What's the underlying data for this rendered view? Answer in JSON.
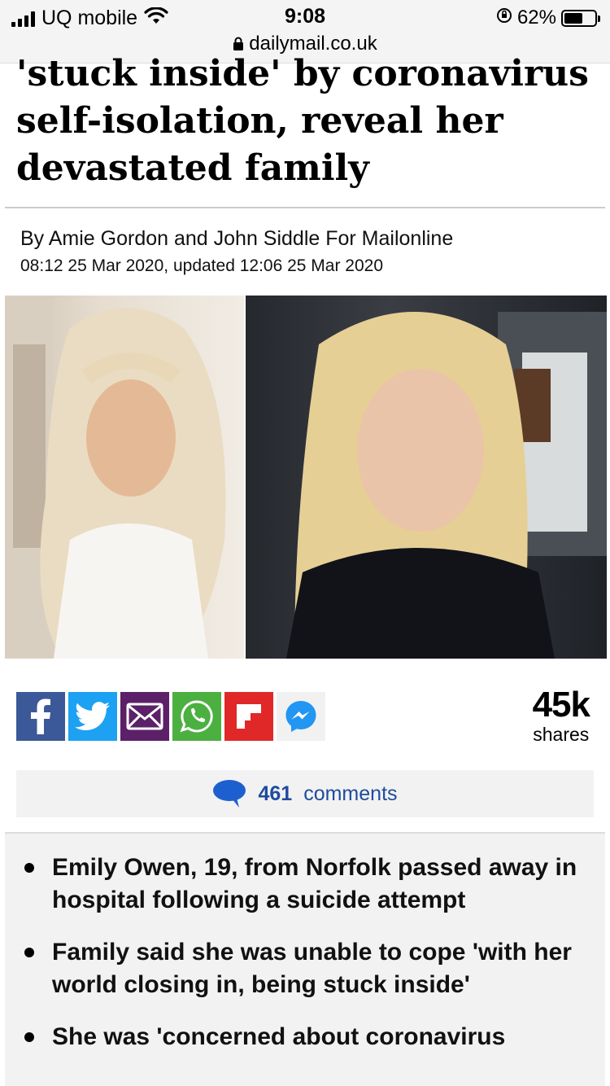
{
  "status_bar": {
    "carrier": "UQ mobile",
    "time": "9:08",
    "battery_percent": "62%",
    "battery_level": 0.62
  },
  "browser": {
    "url": "dailymail.co.uk"
  },
  "article": {
    "headline": "'stuck inside' by coronavirus self-isolation, reveal her devastated family",
    "byline": "By Amie Gordon and John Siddle For Mailonline",
    "dateline": "08:12 25 Mar 2020, updated 12:06 25 Mar 2020",
    "bullets": [
      "Emily Owen, 19, from Norfolk passed away in hospital following a suicide attempt",
      "Family said she was unable to cope 'with her world closing in, being stuck inside'",
      "She was 'concerned about coronavirus"
    ]
  },
  "share": {
    "count": "45k",
    "label": "shares",
    "icons": [
      "facebook-icon",
      "twitter-icon",
      "email-icon",
      "whatsapp-icon",
      "flipboard-icon",
      "messenger-icon"
    ]
  },
  "comments": {
    "count": "461",
    "label": "comments"
  },
  "colors": {
    "facebook": "#3b5998",
    "twitter": "#1da1f2",
    "email": "#5b2067",
    "whatsapp": "#4bb040",
    "flipboard": "#e12828",
    "comments_link": "#1e4b9e"
  }
}
